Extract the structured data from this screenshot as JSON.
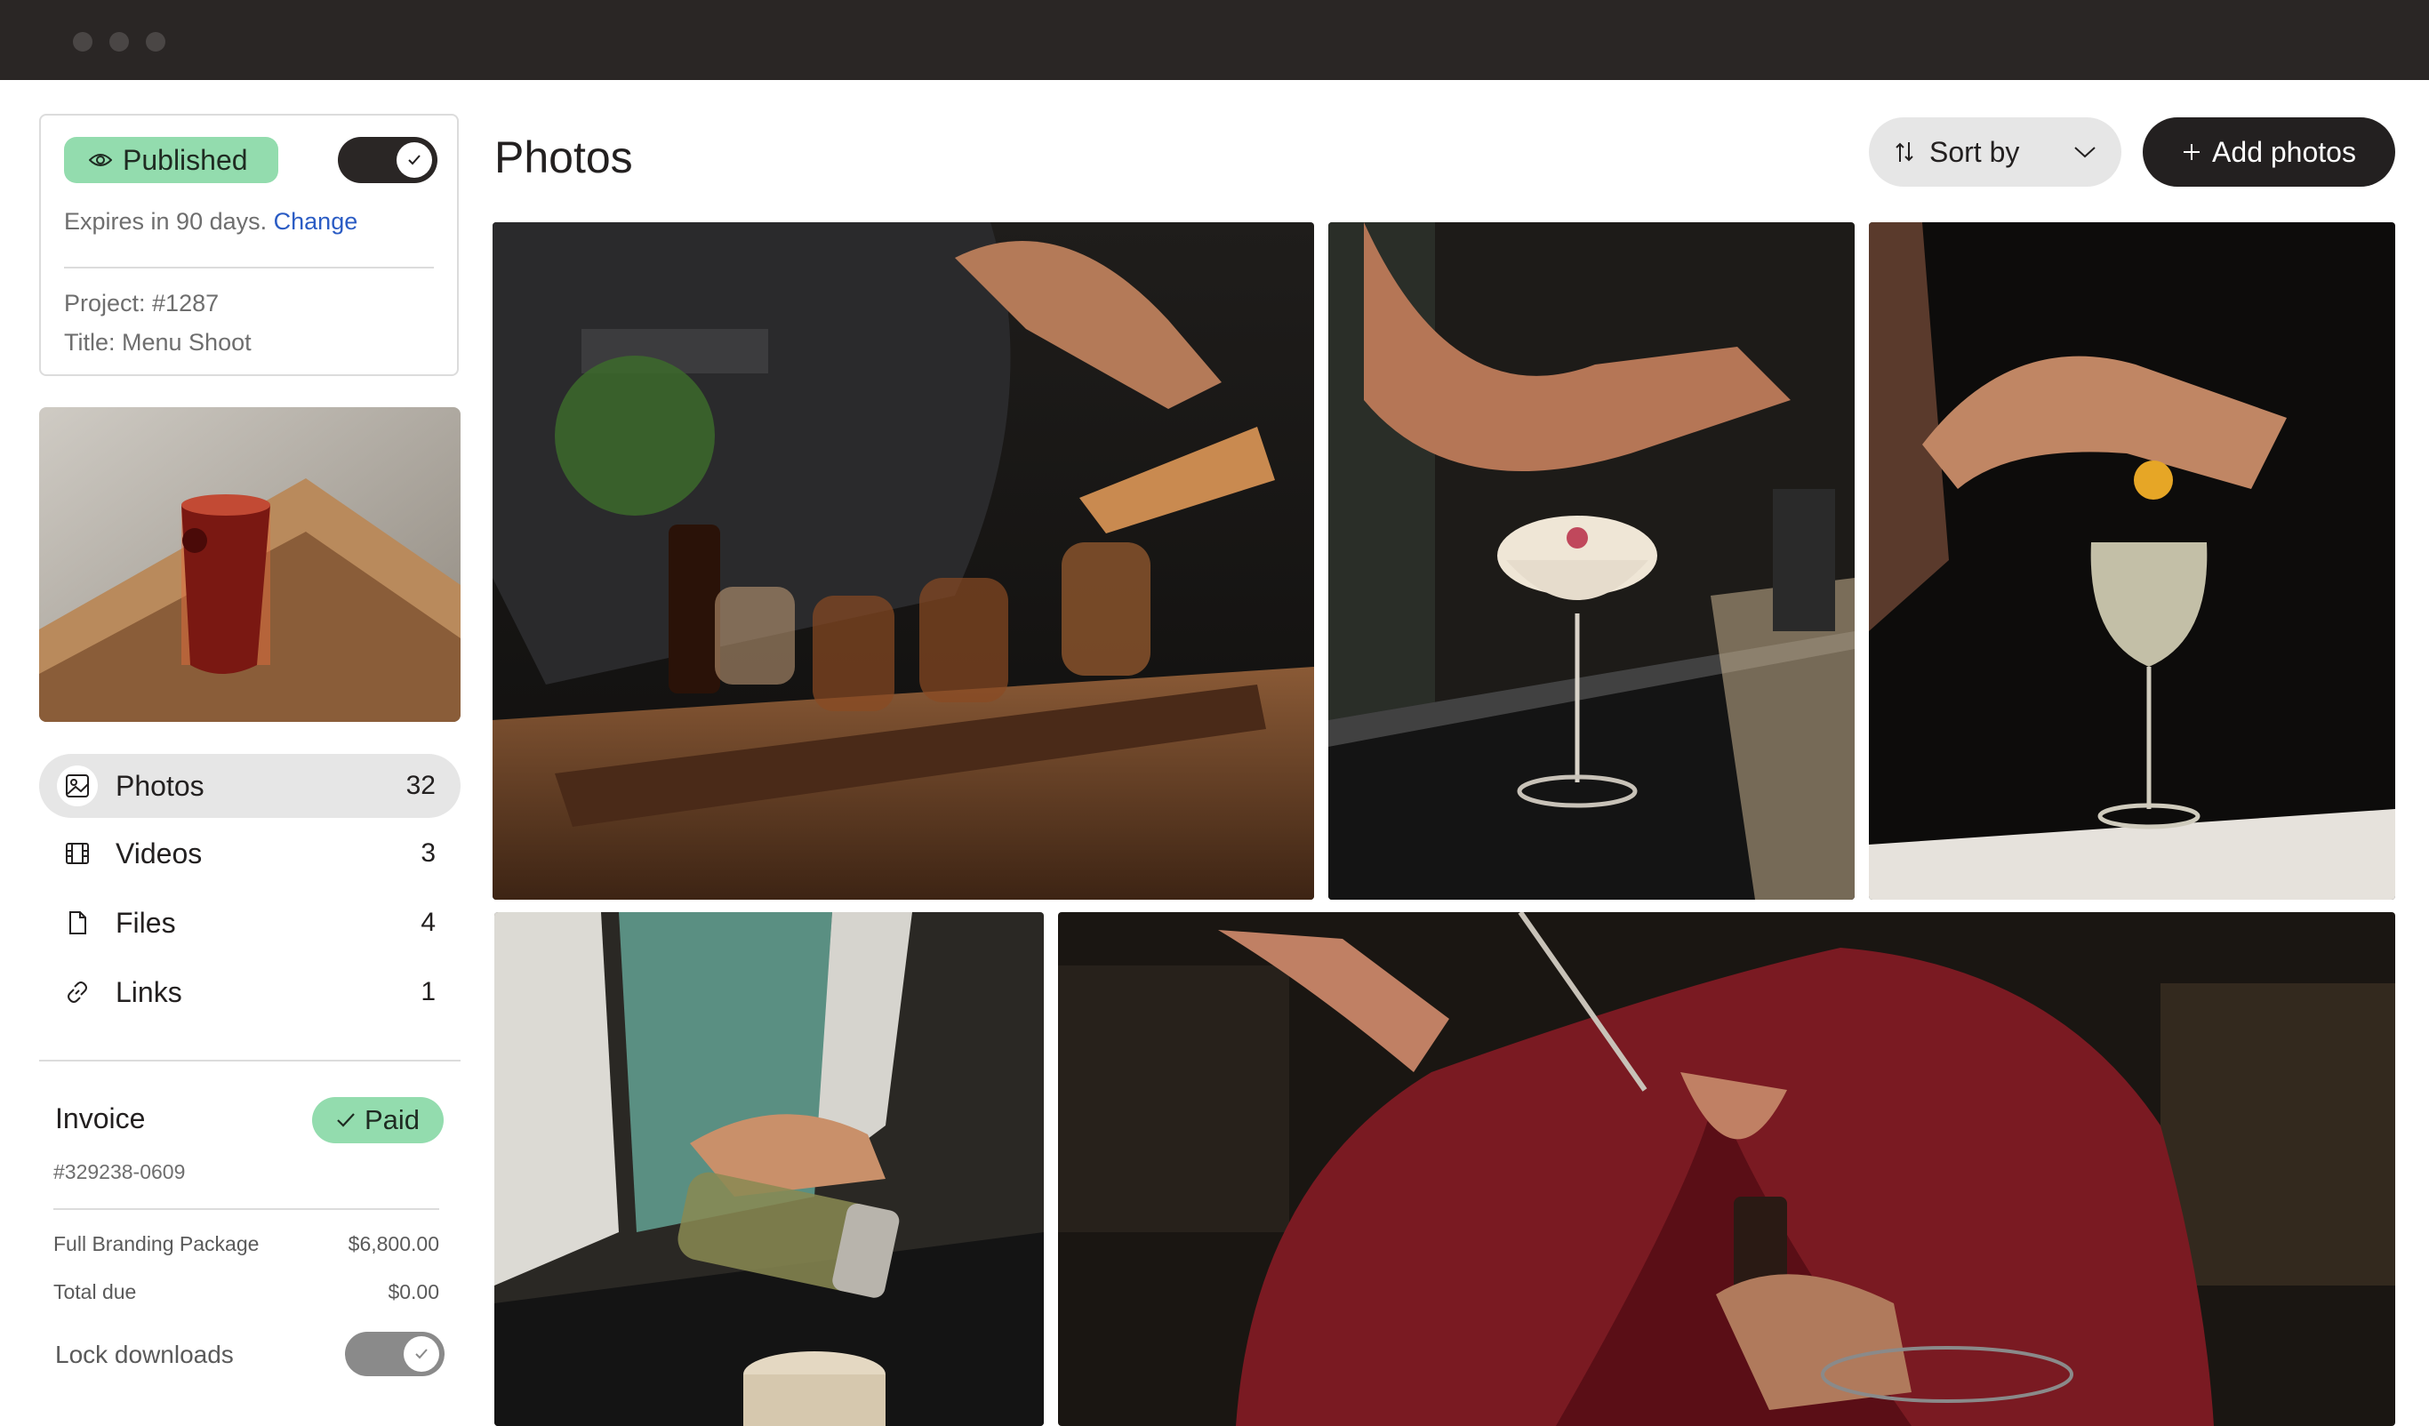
{
  "status": {
    "badge": "Published",
    "expires_text": "Expires in 90 days.",
    "expires_link": "Change",
    "project": "Project: #1287",
    "title": "Title: Menu Shoot"
  },
  "nav": [
    {
      "label": "Photos",
      "count": "32",
      "icon": "image-icon"
    },
    {
      "label": "Videos",
      "count": "3",
      "icon": "film-icon"
    },
    {
      "label": "Files",
      "count": "4",
      "icon": "file-icon"
    },
    {
      "label": "Links",
      "count": "1",
      "icon": "link-icon"
    }
  ],
  "invoice": {
    "title": "Invoice",
    "status": "Paid",
    "number": "#329238-0609",
    "line_items": [
      {
        "label": "Full Branding Package",
        "value": "$6,800.00"
      },
      {
        "label": "Total due",
        "value": "$0.00"
      }
    ],
    "lock_label": "Lock downloads"
  },
  "main": {
    "title": "Photos",
    "sort_label": "Sort by",
    "add_label": "Add photos"
  },
  "colors": {
    "accent_green": "#93dcae",
    "dark": "#232020",
    "link_blue": "#2b5cc4"
  }
}
